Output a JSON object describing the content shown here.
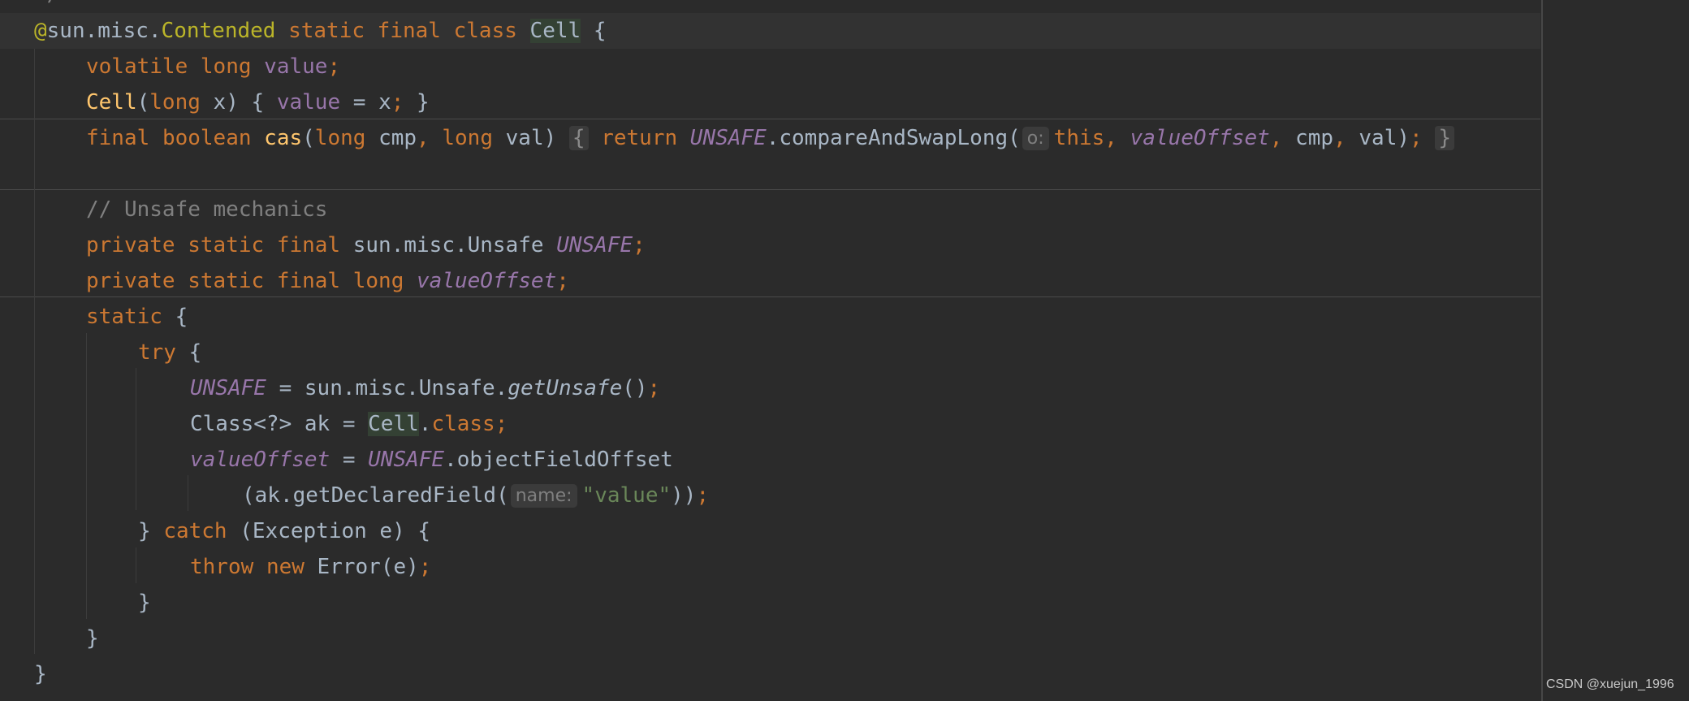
{
  "editor": {
    "top_fragment": "*/",
    "watermark": "CSDN @xuejun_1996",
    "lines": [
      [
        {
          "t": "@",
          "c": "ann"
        },
        {
          "t": "sun.misc.",
          "c": "p"
        },
        {
          "t": "Contended",
          "c": "ann"
        },
        {
          "t": " ",
          "c": "p"
        },
        {
          "t": "static",
          "c": "kw"
        },
        {
          "t": " ",
          "c": "p"
        },
        {
          "t": "final",
          "c": "kw"
        },
        {
          "t": " ",
          "c": "p"
        },
        {
          "t": "class",
          "c": "kw"
        },
        {
          "t": " ",
          "c": "p"
        },
        {
          "t": "Cell",
          "c": "hl"
        },
        {
          "t": " {",
          "c": "p"
        }
      ],
      [
        {
          "t": "volatile",
          "c": "kw"
        },
        {
          "t": " ",
          "c": "p"
        },
        {
          "t": "long",
          "c": "kw"
        },
        {
          "t": " ",
          "c": "p"
        },
        {
          "t": "value",
          "c": "fld"
        },
        {
          "t": ";",
          "c": "kw"
        }
      ],
      [
        {
          "t": "Cell",
          "c": "fn"
        },
        {
          "t": "(",
          "c": "p"
        },
        {
          "t": "long",
          "c": "kw"
        },
        {
          "t": " x) { ",
          "c": "p"
        },
        {
          "t": "value",
          "c": "fld"
        },
        {
          "t": " = x",
          "c": "p"
        },
        {
          "t": ";",
          "c": "kw"
        },
        {
          "t": " }",
          "c": "p"
        }
      ],
      [
        {
          "t": "final",
          "c": "kw"
        },
        {
          "t": " ",
          "c": "p"
        },
        {
          "t": "boolean",
          "c": "kw"
        },
        {
          "t": " ",
          "c": "p"
        },
        {
          "t": "cas",
          "c": "fn"
        },
        {
          "t": "(",
          "c": "p"
        },
        {
          "t": "long",
          "c": "kw"
        },
        {
          "t": " cmp",
          "c": "p"
        },
        {
          "t": ",",
          "c": "kw"
        },
        {
          "t": " ",
          "c": "p"
        },
        {
          "t": "long",
          "c": "kw"
        },
        {
          "t": " val) ",
          "c": "p"
        },
        {
          "t": "{",
          "c": "fold"
        },
        {
          "t": " ",
          "c": "p"
        },
        {
          "t": "return",
          "c": "kw"
        },
        {
          "t": " ",
          "c": "p"
        },
        {
          "t": "UNSAFE",
          "c": "sfld"
        },
        {
          "t": ".compareAndSwapLong(",
          "c": "p"
        },
        {
          "t": "o:",
          "c": "hint"
        },
        {
          "t": "this",
          "c": "kw"
        },
        {
          "t": ",",
          "c": "kw"
        },
        {
          "t": " ",
          "c": "p"
        },
        {
          "t": "valueOffset",
          "c": "sfld"
        },
        {
          "t": ",",
          "c": "kw"
        },
        {
          "t": " cmp",
          "c": "p"
        },
        {
          "t": ",",
          "c": "kw"
        },
        {
          "t": " val)",
          "c": "p"
        },
        {
          "t": ";",
          "c": "kw"
        },
        {
          "t": " ",
          "c": "p"
        },
        {
          "t": "}",
          "c": "fold"
        }
      ],
      [],
      [
        {
          "t": "// Unsafe mechanics",
          "c": "cmt"
        }
      ],
      [
        {
          "t": "private",
          "c": "kw"
        },
        {
          "t": " ",
          "c": "p"
        },
        {
          "t": "static",
          "c": "kw"
        },
        {
          "t": " ",
          "c": "p"
        },
        {
          "t": "final",
          "c": "kw"
        },
        {
          "t": " sun.misc.Unsafe ",
          "c": "p"
        },
        {
          "t": "UNSAFE",
          "c": "sfld"
        },
        {
          "t": ";",
          "c": "kw"
        }
      ],
      [
        {
          "t": "private",
          "c": "kw"
        },
        {
          "t": " ",
          "c": "p"
        },
        {
          "t": "static",
          "c": "kw"
        },
        {
          "t": " ",
          "c": "p"
        },
        {
          "t": "final",
          "c": "kw"
        },
        {
          "t": " ",
          "c": "p"
        },
        {
          "t": "long",
          "c": "kw"
        },
        {
          "t": " ",
          "c": "p"
        },
        {
          "t": "valueOffset",
          "c": "sfld"
        },
        {
          "t": ";",
          "c": "kw"
        }
      ],
      [
        {
          "t": "static",
          "c": "kw"
        },
        {
          "t": " {",
          "c": "p"
        }
      ],
      [
        {
          "t": "try",
          "c": "kw"
        },
        {
          "t": " {",
          "c": "p"
        }
      ],
      [
        {
          "t": "UNSAFE",
          "c": "sfld"
        },
        {
          "t": " = sun.misc.Unsafe.",
          "c": "p"
        },
        {
          "t": "getUnsafe",
          "c": "smeth"
        },
        {
          "t": "()",
          "c": "p"
        },
        {
          "t": ";",
          "c": "kw"
        }
      ],
      [
        {
          "t": "Class<?> ak = ",
          "c": "p"
        },
        {
          "t": "Cell",
          "c": "hl"
        },
        {
          "t": ".",
          "c": "p"
        },
        {
          "t": "class",
          "c": "kw"
        },
        {
          "t": ";",
          "c": "kw"
        }
      ],
      [
        {
          "t": "valueOffset",
          "c": "sfld"
        },
        {
          "t": " = ",
          "c": "p"
        },
        {
          "t": "UNSAFE",
          "c": "sfld"
        },
        {
          "t": ".objectFieldOffset",
          "c": "p"
        }
      ],
      [
        {
          "t": "(ak.getDeclaredField(",
          "c": "p"
        },
        {
          "t": "name:",
          "c": "hint"
        },
        {
          "t": "\"value\"",
          "c": "str"
        },
        {
          "t": "))",
          "c": "p"
        },
        {
          "t": ";",
          "c": "kw"
        }
      ],
      [
        {
          "t": "} ",
          "c": "p"
        },
        {
          "t": "catch",
          "c": "kw"
        },
        {
          "t": " (Exception e) {",
          "c": "p"
        }
      ],
      [
        {
          "t": "throw",
          "c": "kw"
        },
        {
          "t": " ",
          "c": "p"
        },
        {
          "t": "new",
          "c": "kw"
        },
        {
          "t": " Error(e)",
          "c": "p"
        },
        {
          "t": ";",
          "c": "kw"
        }
      ],
      [
        {
          "t": "}",
          "c": "p"
        }
      ],
      [
        {
          "t": "}",
          "c": "p"
        }
      ],
      [
        {
          "t": "}",
          "c": "p"
        }
      ]
    ]
  }
}
